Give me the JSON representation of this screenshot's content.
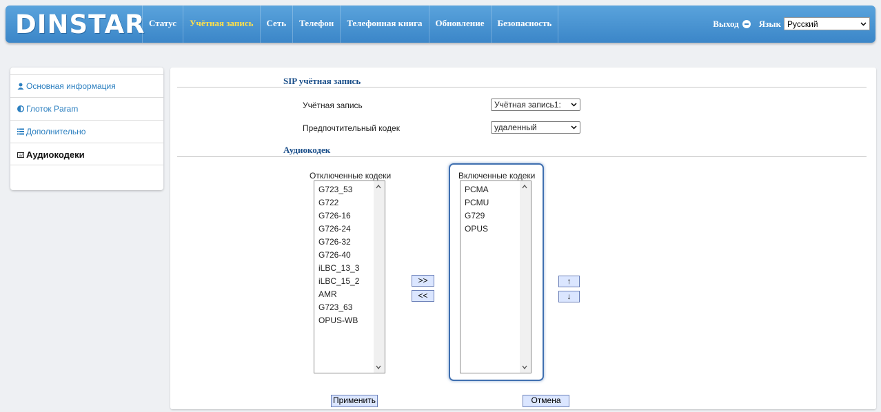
{
  "brand": {
    "logo": "DINSTAR"
  },
  "nav": {
    "items": [
      {
        "label": "Статус"
      },
      {
        "label": "Учётная запись"
      },
      {
        "label": "Сеть"
      },
      {
        "label": "Телефон"
      },
      {
        "label": "Телефонная книга"
      },
      {
        "label": "Обновление"
      },
      {
        "label": "Безопасность"
      }
    ],
    "active_index": 1
  },
  "header_right": {
    "logout_label": "Выход",
    "language_label": "Язык",
    "language_value": "Русский"
  },
  "sidebar": {
    "items": [
      {
        "label": "Основная информация",
        "icon": "user-icon"
      },
      {
        "label": "Глоток Param",
        "icon": "half-circle-icon"
      },
      {
        "label": "Дополнительно",
        "icon": "list-icon"
      },
      {
        "label": "Аудиокодеки",
        "icon": "keyboard-icon",
        "active": true
      }
    ]
  },
  "main": {
    "sip_section_title": "SIP учётная запись",
    "account_label": "Учётная запись",
    "account_value": "Учётная запись1: ",
    "preferred_codec_label": "Предпочтительный кодек",
    "preferred_codec_value": "удаленный",
    "audio_section_title": "Аудиокодек",
    "disabled_caption": "Отключенные кодеки",
    "enabled_caption": "Включенные кодеки",
    "disabled_codecs": [
      "G723_53",
      "G722",
      "G726-16",
      "G726-24",
      "G726-32",
      "G726-40",
      "iLBC_13_3",
      "iLBC_15_2",
      "AMR",
      "G723_63",
      "OPUS-WB"
    ],
    "enabled_codecs": [
      "PCMA",
      "PCMU",
      "G729",
      "OPUS"
    ],
    "move_right_label": ">>",
    "move_left_label": "<<",
    "move_up_label": "↑",
    "move_down_label": "↓",
    "apply_label": "Применить",
    "cancel_label": "Отмена"
  },
  "colors": {
    "header_blue": "#3b86c8",
    "active_nav": "#ffe04b",
    "section_title": "#1b4f8a",
    "link_blue": "#2b7fc0",
    "button_bg": "#dbe6ff"
  }
}
